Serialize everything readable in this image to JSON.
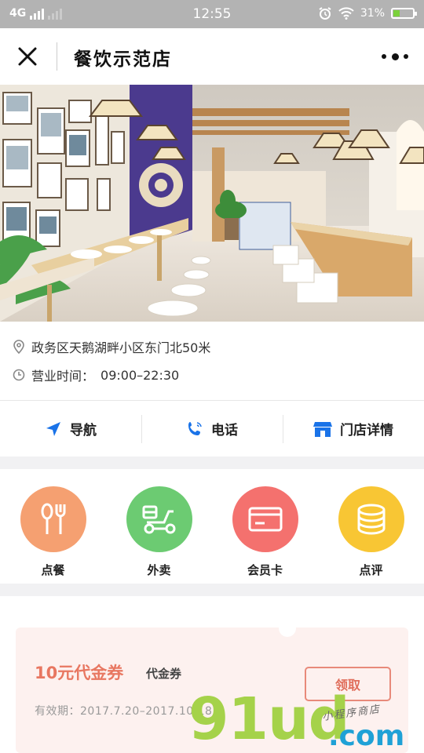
{
  "status_bar": {
    "network": "4G",
    "time": "12:55",
    "battery_percent": "31%",
    "battery_level": 0.31,
    "icons": [
      "signal-icon",
      "alarm-icon",
      "wifi-icon",
      "battery-icon"
    ]
  },
  "nav": {
    "title": "餐饮示范店",
    "close_icon": "close-icon",
    "more_icon": "more-icon"
  },
  "store": {
    "address": "政务区天鹅湖畔小区东门北50米",
    "hours_label": "营业时间：",
    "hours_value": "09:00–22:30"
  },
  "actions": [
    {
      "label": "导航",
      "icon": "navigation-icon",
      "color": "#1a73e8"
    },
    {
      "label": "电话",
      "icon": "phone-icon",
      "color": "#1a73e8"
    },
    {
      "label": "门店详情",
      "icon": "store-icon",
      "color": "#1a73e8"
    }
  ],
  "features": [
    {
      "label": "点餐",
      "icon": "utensils-icon",
      "color": "#f5a071"
    },
    {
      "label": "外卖",
      "icon": "scooter-icon",
      "color": "#6ccb72"
    },
    {
      "label": "会员卡",
      "icon": "card-icon",
      "color": "#f4716e"
    },
    {
      "label": "点评",
      "icon": "coins-icon",
      "color": "#f8c634"
    }
  ],
  "coupon": {
    "title": "10元代金券",
    "type": "代金券",
    "validity": "有效期：2017.7.20–2017.10.18",
    "button": "领取"
  },
  "watermark": {
    "brand": "91ud",
    "domain": ".com",
    "tagline": "小程序商店"
  }
}
